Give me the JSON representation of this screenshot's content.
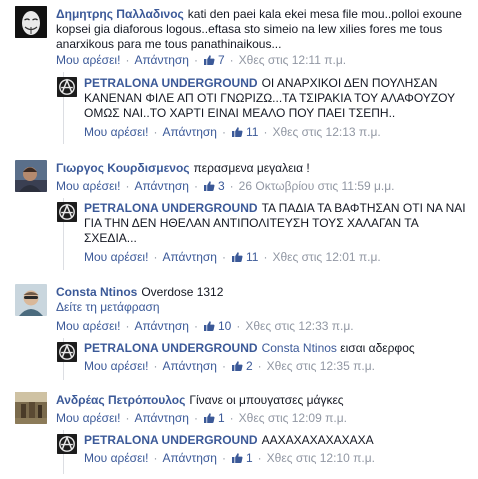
{
  "like_label": "Μου αρέσει!",
  "reply_label": "Απάντηση",
  "thumb_icon": "thumbs-up-icon",
  "comments": [
    {
      "author": "Δημητρης Παλλαδινος",
      "text": "kati den paei kala ekei mesa file mou..polloi exoune kopsei gia diaforous logous..eftasa sto simeio na lew xilies fores me tous anarxikous para me tous panathinaikous...",
      "likes": "7",
      "time": "Χθες στις 12:11 π.μ.",
      "reply": {
        "author": "PETRALONA UNDERGROUND",
        "text": "ΟΙ ΑΝΑΡΧΙΚΟΙ ΔΕΝ ΠΟΥΛΗΣΑΝ ΚΑΝΕΝΑΝ ΦΙΛΕ ΑΠ ΟΤΙ ΓΝΩΡΙΖΩ...ΤΑ ΤΣΙΡΑΚΙΑ ΤΟΥ ΑΛΑΦΟΥΖΟΥ ΟΜΩΣ ΝΑΙ..ΤΟ ΧΑΡΤΙ ΕΙΝΑΙ ΜΕΑΛΟ ΠΟΥ ΠΑΕΙ ΤΣΕΠΗ..",
        "likes": "11",
        "time": "Χθες στις 12:13 π.μ."
      }
    },
    {
      "author": "Γιωργος Κουρδισμενος",
      "text": "περασμενα μεγαλεια !",
      "likes": "3",
      "time": "26 Οκτωβρίου στις 11:59 μ.μ.",
      "reply": {
        "author": "PETRALONA UNDERGROUND",
        "text": "ΤΑ ΠΑΔΙΑ ΤΑ ΒΑΦΤΗΣΑΝ ΟΤΙ ΝΑ ΝΑΙ ΓΙΑ ΤΗΝ ΔΕΝ ΗΘΕΛΑΝ ΑΝΤΙΠΟΛΙΤΕΥΣΗ ΤΟΥΣ ΧΑΛΑΓΑΝ ΤΑ ΣΧΕΔΙΑ...",
        "likes": "11",
        "time": "Χθες στις 12:01 π.μ."
      }
    },
    {
      "author": "Consta Ntinos",
      "text": "Overdose 1312",
      "see_translation": "Δείτε τη μετάφραση",
      "likes": "10",
      "time": "Χθες στις 12:33 π.μ.",
      "reply": {
        "author": "PETRALONA UNDERGROUND",
        "mention": "Consta Ntinos",
        "text": "εισαι αδερφος",
        "likes": "2",
        "time": "Χθες στις 12:35 π.μ."
      }
    },
    {
      "author": "Ανδρέας Πετρόπουλος",
      "text": "Γίνανε οι μπουγατσες μάγκες",
      "likes": "1",
      "time": "Χθες στις 12:09 π.μ.",
      "reply": {
        "author": "PETRALONA UNDERGROUND",
        "text": "ΑΑΧΑΧΑΧΑΧΑΧΑΧΑ",
        "likes": "1",
        "time": "Χθες στις 12:10 π.μ."
      }
    }
  ]
}
